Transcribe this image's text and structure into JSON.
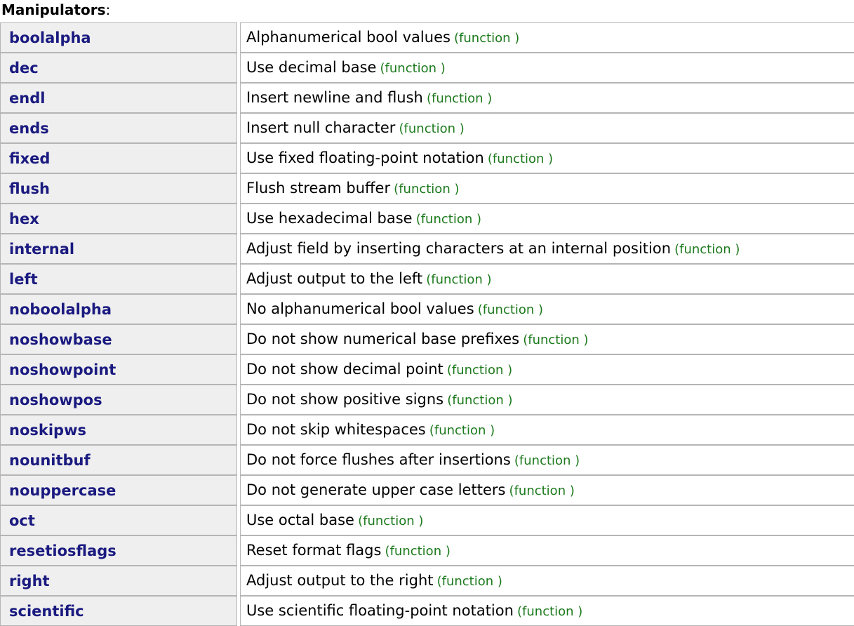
{
  "page": {
    "title": "Manipulators",
    "title_suffix": ":",
    "colors": {
      "link": "#1a1a80",
      "kind_tag": "#1c7a1c",
      "cell_background": "#efefef",
      "cell_border": "#b5b5b5",
      "page_background": "#ffffff",
      "text": "#000000"
    }
  },
  "table": {
    "kind_label": "(function )",
    "rows": [
      {
        "name": "boolalpha",
        "description": "Alphanumerical bool values",
        "kind": "(function )"
      },
      {
        "name": "dec",
        "description": "Use decimal base",
        "kind": "(function )"
      },
      {
        "name": "endl",
        "description": "Insert newline and flush",
        "kind": "(function )"
      },
      {
        "name": "ends",
        "description": "Insert null character",
        "kind": "(function )"
      },
      {
        "name": "fixed",
        "description": "Use fixed floating-point notation",
        "kind": "(function )"
      },
      {
        "name": "flush",
        "description": "Flush stream buffer",
        "kind": "(function )"
      },
      {
        "name": "hex",
        "description": "Use hexadecimal base",
        "kind": "(function )"
      },
      {
        "name": "internal",
        "description": "Adjust field by inserting characters at an internal position",
        "kind": "(function )"
      },
      {
        "name": "left",
        "description": "Adjust output to the left",
        "kind": "(function )"
      },
      {
        "name": "noboolalpha",
        "description": "No alphanumerical bool values",
        "kind": "(function )"
      },
      {
        "name": "noshowbase",
        "description": "Do not show numerical base prefixes",
        "kind": "(function )"
      },
      {
        "name": "noshowpoint",
        "description": "Do not show decimal point",
        "kind": "(function )"
      },
      {
        "name": "noshowpos",
        "description": "Do not show positive signs",
        "kind": "(function )"
      },
      {
        "name": "noskipws",
        "description": "Do not skip whitespaces",
        "kind": "(function )"
      },
      {
        "name": "nounitbuf",
        "description": "Do not force flushes after insertions",
        "kind": "(function )"
      },
      {
        "name": "nouppercase",
        "description": "Do not generate upper case letters",
        "kind": "(function )"
      },
      {
        "name": "oct",
        "description": "Use octal base",
        "kind": "(function )"
      },
      {
        "name": "resetiosflags",
        "description": "Reset format flags",
        "kind": "(function )"
      },
      {
        "name": "right",
        "description": "Adjust output to the right",
        "kind": "(function )"
      },
      {
        "name": "scientific",
        "description": "Use scientific floating-point notation",
        "kind": "(function )"
      }
    ]
  }
}
